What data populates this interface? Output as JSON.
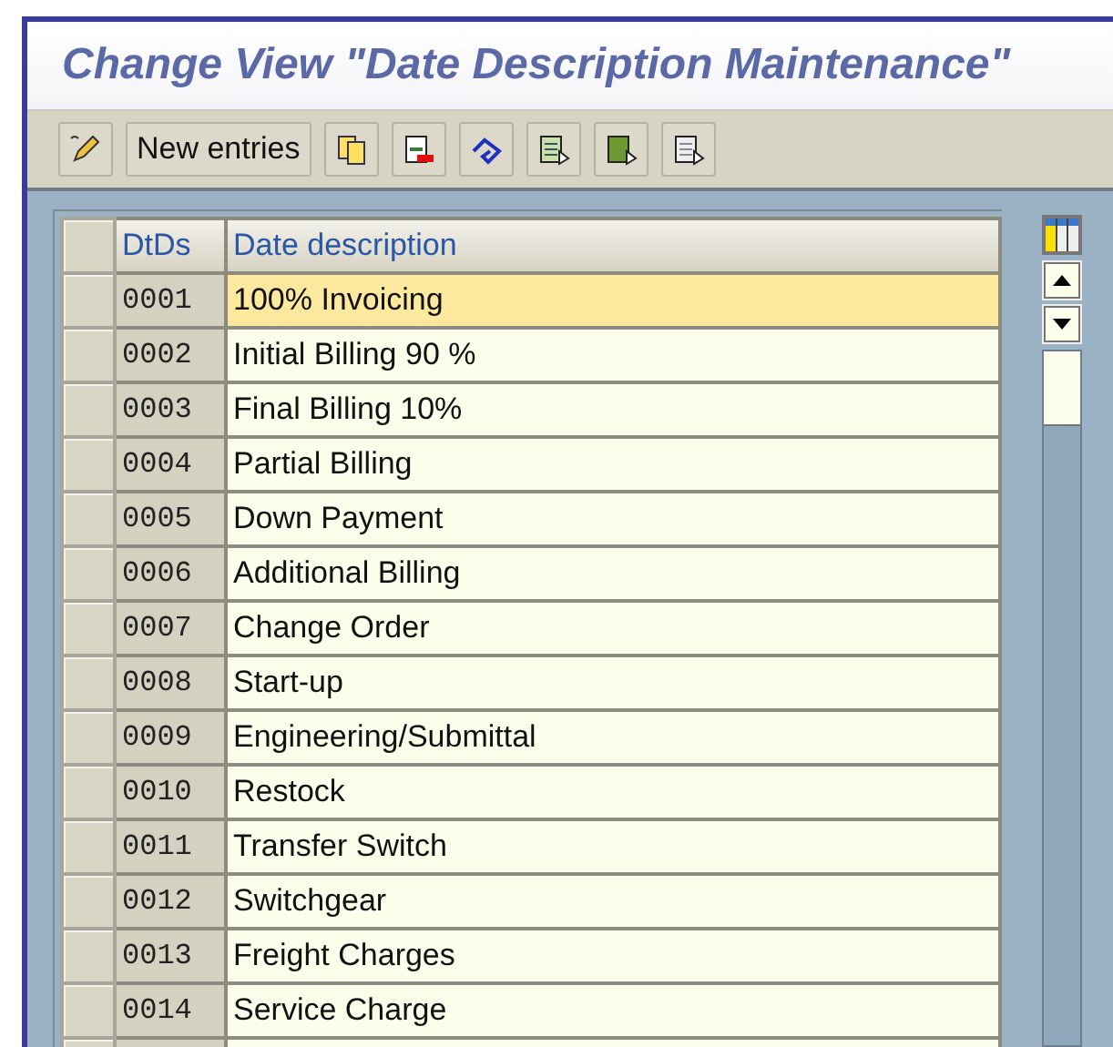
{
  "window": {
    "title": "Change View \"Date Description Maintenance\""
  },
  "toolbar": {
    "new_entries_button": "New entries"
  },
  "table": {
    "columns": [
      "DtDs",
      "Date description"
    ],
    "rows": [
      {
        "key": "0001",
        "description": "100% Invoicing",
        "selected": true
      },
      {
        "key": "0002",
        "description": "Initial Billing 90 %",
        "selected": false
      },
      {
        "key": "0003",
        "description": "Final Billing 10%",
        "selected": false
      },
      {
        "key": "0004",
        "description": "Partial Billing",
        "selected": false
      },
      {
        "key": "0005",
        "description": "Down Payment",
        "selected": false
      },
      {
        "key": "0006",
        "description": "Additional Billing",
        "selected": false
      },
      {
        "key": "0007",
        "description": "Change Order",
        "selected": false
      },
      {
        "key": "0008",
        "description": "Start-up",
        "selected": false
      },
      {
        "key": "0009",
        "description": "Engineering/Submittal",
        "selected": false
      },
      {
        "key": "0010",
        "description": "Restock",
        "selected": false
      },
      {
        "key": "0011",
        "description": "Transfer Switch",
        "selected": false
      },
      {
        "key": "0012",
        "description": "Switchgear",
        "selected": false
      },
      {
        "key": "0013",
        "description": "Freight Charges",
        "selected": false
      },
      {
        "key": "0014",
        "description": "Service Charge",
        "selected": false
      }
    ]
  }
}
